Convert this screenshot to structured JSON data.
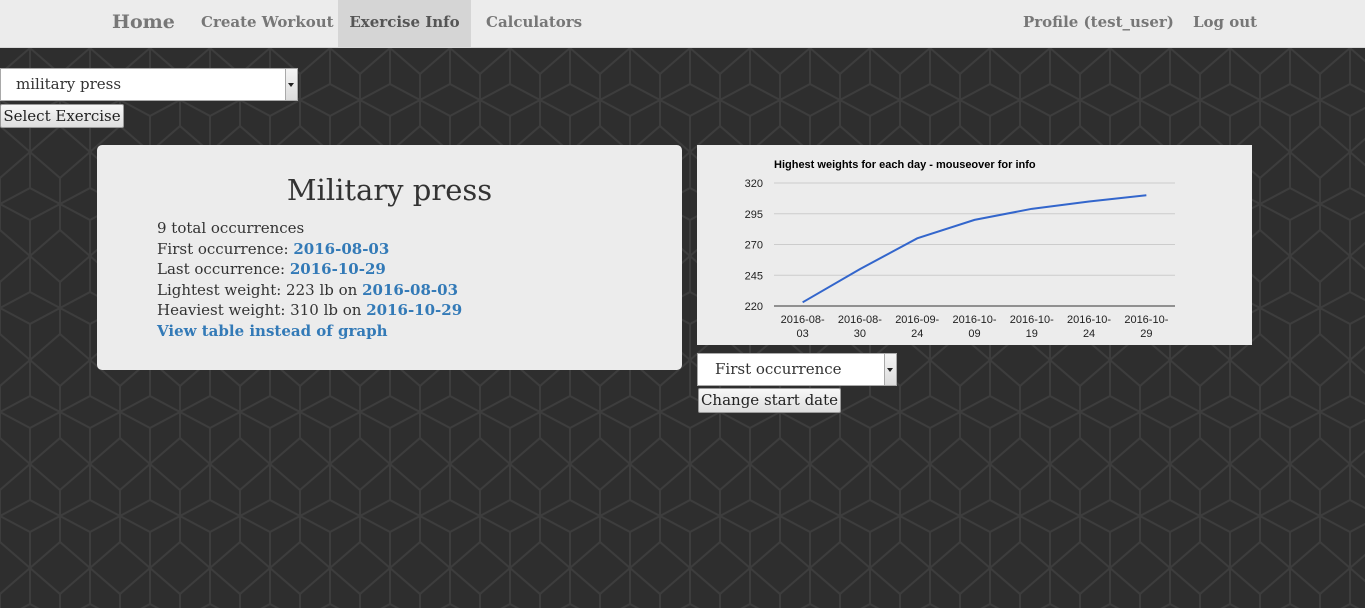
{
  "nav": {
    "brand": "Home",
    "left_items": [
      {
        "label": "Create Workout",
        "active": false
      },
      {
        "label": "Exercise Info",
        "active": true
      },
      {
        "label": "Calculators",
        "active": false
      }
    ],
    "right_items": [
      {
        "label": "Profile (test_user)"
      },
      {
        "label": "Log out"
      }
    ]
  },
  "exercise_selector": {
    "selected": "military press",
    "button_label": "Select Exercise"
  },
  "info": {
    "title": "Military press",
    "total_occurrences": "9 total occurrences",
    "first_label": "First occurrence: ",
    "first_date": "2016-08-03",
    "last_label": "Last occurrence: ",
    "last_date": "2016-10-29",
    "lightest_label": "Lightest weight: 223 lb on ",
    "lightest_date": "2016-08-03",
    "heaviest_label": "Heaviest weight: 310 lb on ",
    "heaviest_date": "2016-10-29",
    "view_table_link": "View table instead of graph"
  },
  "start_date_selector": {
    "selected": "First occurrence",
    "button_label": "Change start date"
  },
  "colors": {
    "background": "#2e2e2e",
    "navbar": "#ececec",
    "link": "#337ab7",
    "line": "#3366cc"
  },
  "chart_data": {
    "type": "line",
    "title": "Highest weights for each day - mouseover for info",
    "categories": [
      "2016-08-03",
      "2016-08-30",
      "2016-09-24",
      "2016-10-09",
      "2016-10-19",
      "2016-10-24",
      "2016-10-29"
    ],
    "tick_labels": [
      [
        "2016-08-",
        "03"
      ],
      [
        "2016-08-",
        "30"
      ],
      [
        "2016-09-",
        "24"
      ],
      [
        "2016-10-",
        "09"
      ],
      [
        "2016-10-",
        "19"
      ],
      [
        "2016-10-",
        "24"
      ],
      [
        "2016-10-",
        "29"
      ]
    ],
    "values": [
      223,
      250,
      275,
      290,
      299,
      305,
      310
    ],
    "ylim": [
      220,
      320
    ],
    "yticks": [
      220,
      245,
      270,
      295,
      320
    ],
    "grid": true,
    "legend": "none"
  }
}
